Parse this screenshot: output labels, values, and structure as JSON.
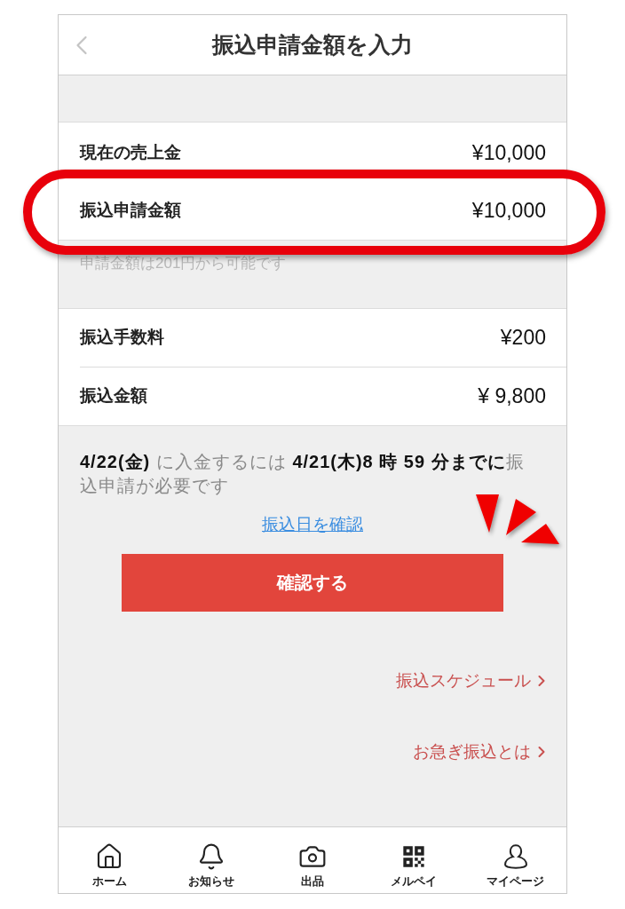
{
  "header": {
    "title": "振込申請金額を入力"
  },
  "amounts": [
    {
      "label": "現在の売上金",
      "value": "¥10,000",
      "highlighted": false
    },
    {
      "label": "振込申請金額",
      "value": "¥10,000",
      "highlighted": true
    }
  ],
  "amount_hint": "申請金額は201円から可能です",
  "transfer": [
    {
      "label": "振込手数料",
      "value": "¥200"
    },
    {
      "label": "振込金額",
      "value": "¥ 9,800"
    }
  ],
  "notice": "**4/22(金)** に入金するには **4/21(木)8 時 59 分までに**振込申請が必要です",
  "date_link": "振込日を確認",
  "confirm_button": "確認する",
  "info_links": [
    "振込スケジュール",
    "お急ぎ振込とは"
  ],
  "tab_bar": [
    {
      "label": "ホーム",
      "selected": false
    },
    {
      "label": "お知らせ",
      "selected": false
    },
    {
      "label": "出品",
      "selected": false
    },
    {
      "label": "メルペイ",
      "selected": false
    },
    {
      "label": "マイページ",
      "selected": false
    }
  ]
}
